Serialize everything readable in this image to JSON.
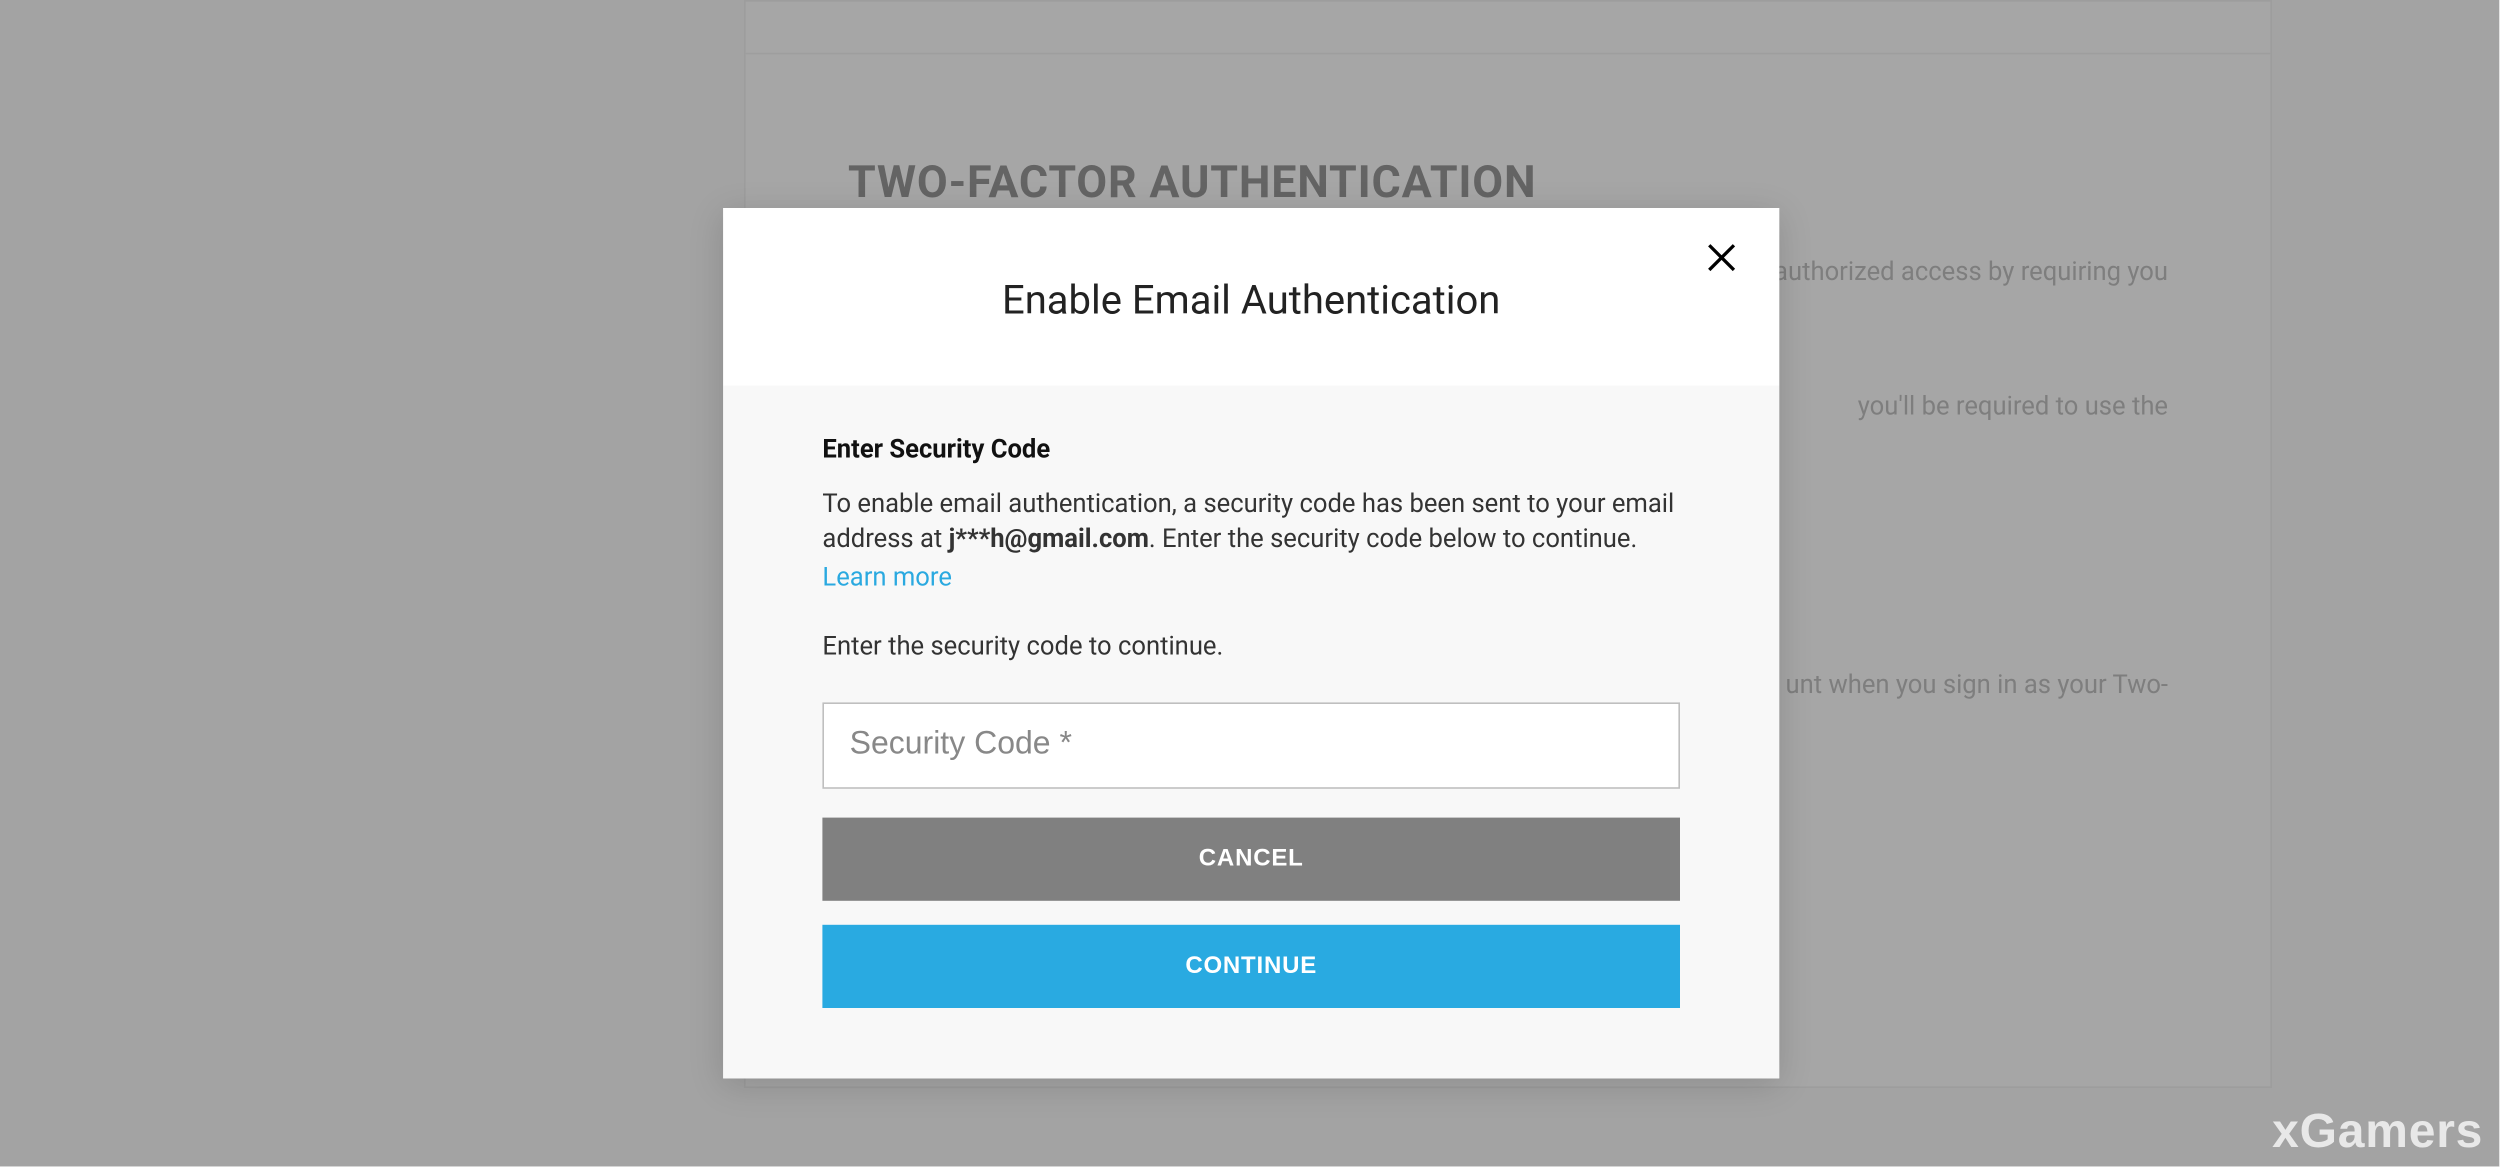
{
  "background": {
    "section_title": "TWO-FACTOR AUTHENTICATION",
    "desc_line": "authorized access by requiring you",
    "sub_line": "you'll be required to use the",
    "sub_line_2": "unt when you sign in as your Two-"
  },
  "modal": {
    "title": "Enable Email Authentication",
    "heading": "Enter Security Code",
    "desc_1": "To enable email authentication, a security code has been sent to your email address at ",
    "masked_email": "j***h@gmail.com",
    "desc_2": ". Enter the security code below to continue.",
    "learn_more": "Learn more",
    "prompt": "Enter the security code to continue.",
    "input_placeholder": "Security Code *",
    "cancel_label": "CANCEL",
    "continue_label": "CONTINUE"
  },
  "watermark": "xGamers"
}
